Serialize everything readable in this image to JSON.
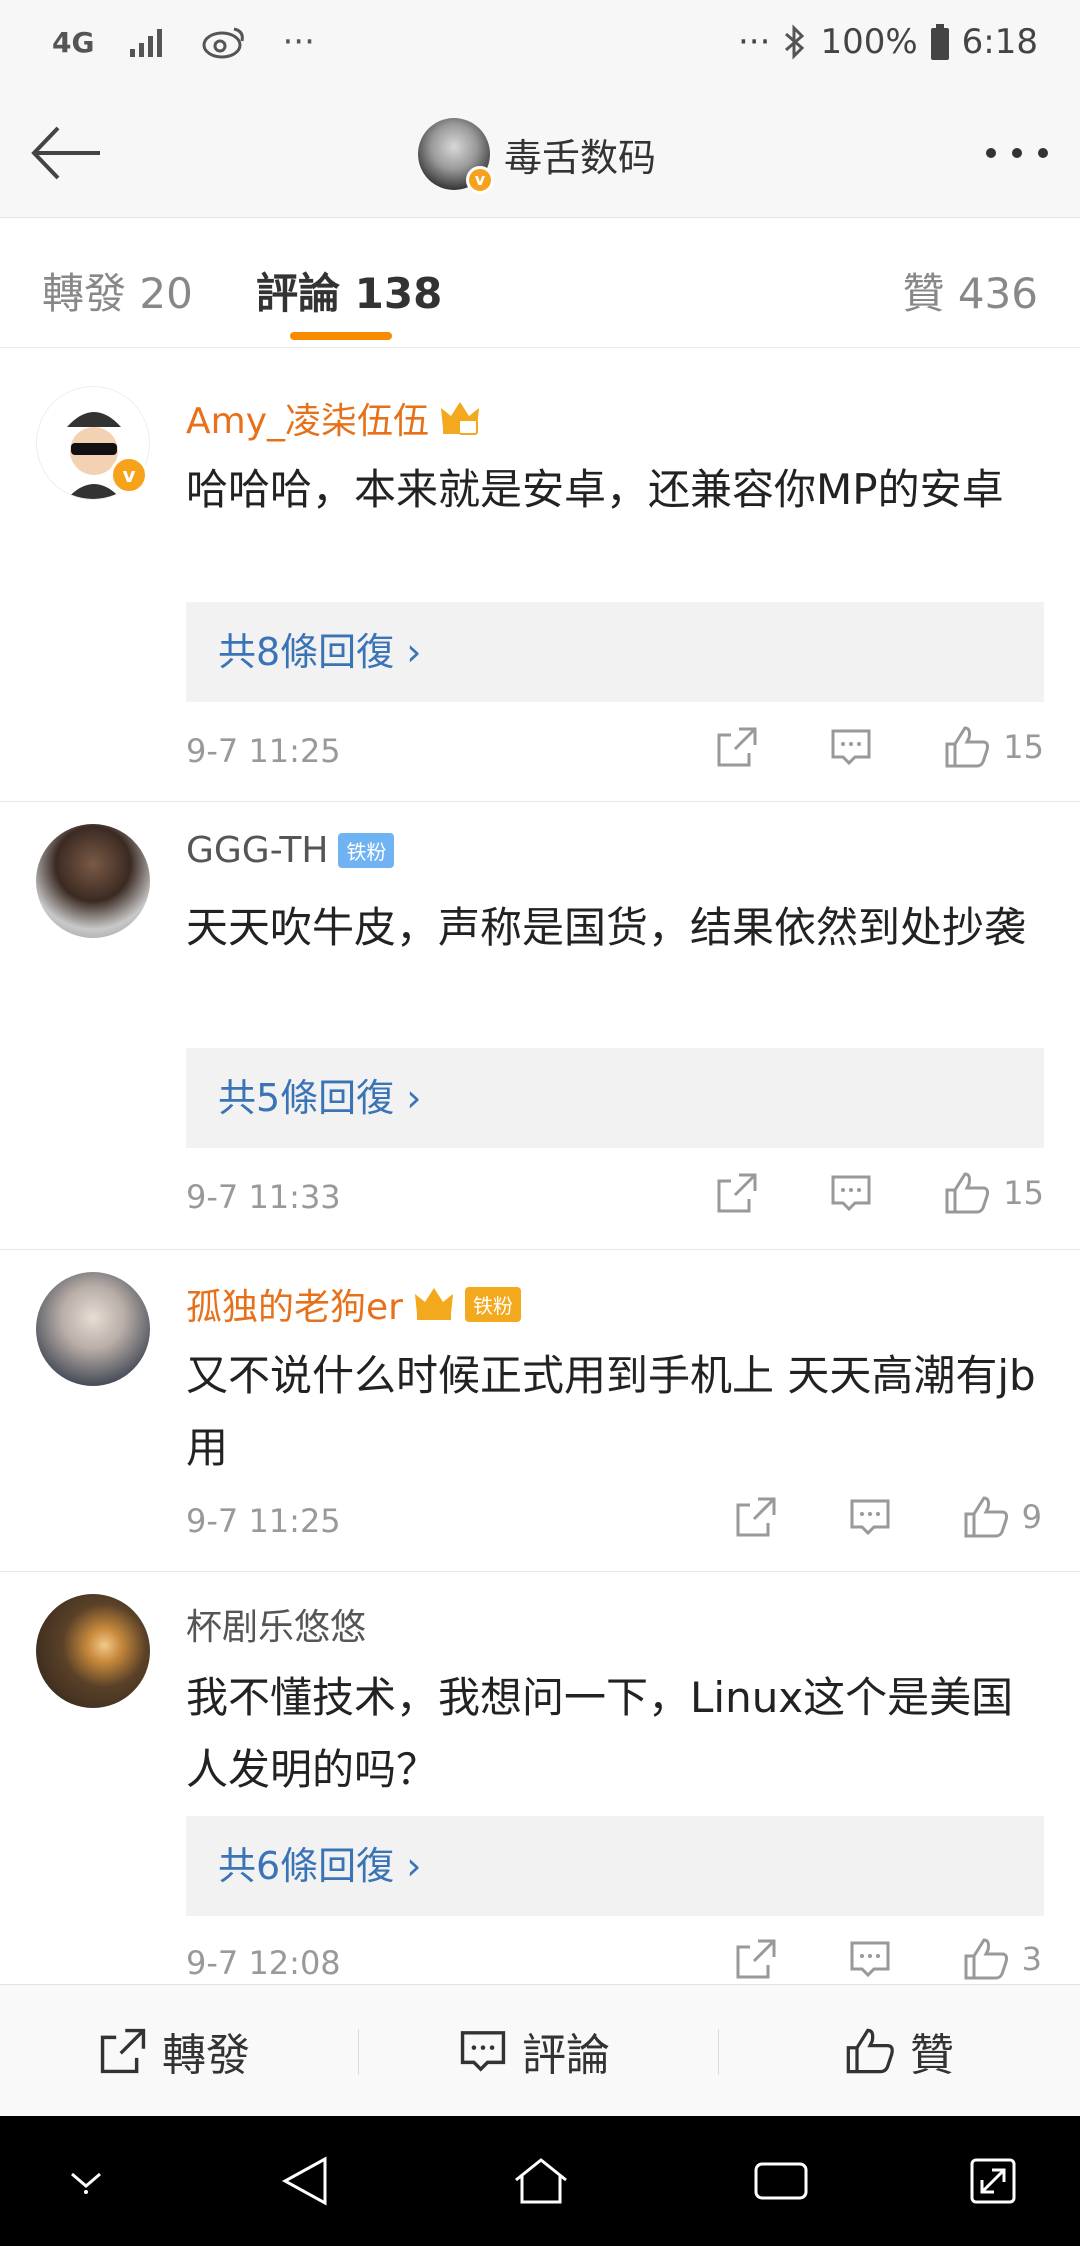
{
  "status_bar": {
    "network": "4G",
    "battery": "100%",
    "time": "6:18",
    "dots": "···",
    "dots2": "···"
  },
  "header": {
    "title": "毒舌数码"
  },
  "tabs": [
    {
      "label": "轉發 20"
    },
    {
      "label": "評論 138"
    },
    {
      "label": "贊 436"
    }
  ],
  "comments": [
    {
      "user": "Amy_凌柒伍伍",
      "text": "哈哈哈，本来就是安卓，还兼容你MP的安卓",
      "replies": "共8條回復",
      "time": "9-7 11:25",
      "likes": "15"
    },
    {
      "user": "GGG-TH",
      "badge": "铁粉",
      "text": "天天吹牛皮，声称是国货，结果依然到处抄袭",
      "replies": "共5條回復",
      "time": "9-7 11:33",
      "likes": "15"
    },
    {
      "user": "孤独的老狗er",
      "badge": "铁粉",
      "text": "又不说什么时候正式用到手机上 天天高潮有jb用",
      "time": "9-7 11:25",
      "likes": "9"
    },
    {
      "user": "杯剧乐悠悠",
      "text": "我不懂技术，我想问一下，Linux这个是美国人发明的吗？",
      "replies": "共6條回復",
      "time": "9-7 12:08",
      "likes": "3"
    }
  ],
  "bottom_bar": {
    "repost": "轉發",
    "comment": "評論",
    "like": "贊"
  },
  "colors": {
    "accent": "#f98b00",
    "link": "#3a74b6",
    "vip_name": "#e7711b"
  }
}
